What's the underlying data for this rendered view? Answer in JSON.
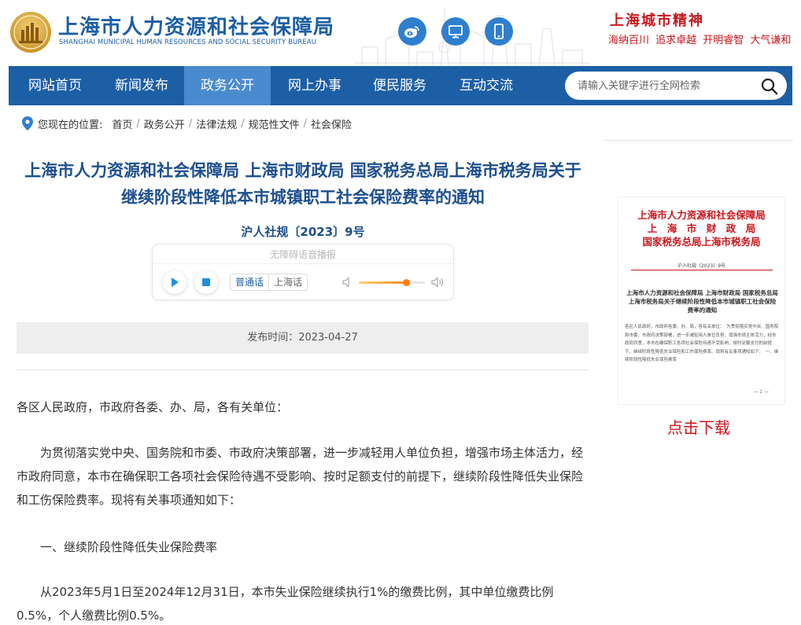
{
  "header": {
    "logo_cn": "上海市人力资源和社会保障局",
    "logo_en": "SHANGHAI MUNICIPAL HUMAN RESOURCES AND SOCIAL SECURITY BUREAU",
    "icons": [
      "weibo-icon",
      "desktop-icon",
      "mobile-icon"
    ],
    "spirit_title": "上海城市精神",
    "spirit_words": "海纳百川  追求卓越  开明睿智  大气谦和"
  },
  "nav": {
    "items": [
      {
        "label": "网站首页"
      },
      {
        "label": "新闻发布"
      },
      {
        "label": "政务公开",
        "active": true
      },
      {
        "label": "网上办事"
      },
      {
        "label": "便民服务"
      },
      {
        "label": "互动交流"
      }
    ],
    "search_placeholder": "请输入关键字进行全网检索"
  },
  "breadcrumb": {
    "label": "您现在的位置:",
    "items": [
      "首页",
      "政务公开",
      "法律法规",
      "规范性文件",
      "社会保险"
    ]
  },
  "article": {
    "title": "上海市人力资源和社会保障局 上海市财政局 国家税务总局上海市税务局关于继续阶段性降低本市城镇职工社会保险费率的通知",
    "doc_number": "沪人社规〔2023〕9号",
    "player": {
      "label": "无障碍语音播报",
      "lang_mandarin": "普通话",
      "lang_shanghai": "上海话",
      "volume_level": 0.72
    },
    "publish_time": "发布时间：2023-04-27",
    "paragraphs": [
      "各区人民政府，市政府各委、办、局，各有关单位：",
      "为贯彻落实党中央、国务院和市委、市政府决策部署，进一步减轻用人单位负担，增强市场主体活力，经市政府同意，本市在确保职工各项社会保险待遇不受影响、按时足额支付的前提下，继续阶段性降低失业保险和工伤保险费率。现将有关事项通知如下：",
      "一、继续阶段性降低失业保险费率",
      "从2023年5月1日至2024年12月31日，本市失业保险继续执行1%的缴费比例，其中单位缴费比例0.5%，个人缴费比例0.5%。"
    ]
  },
  "sidebar": {
    "preview": {
      "head_lines": [
        "上海市人力资源和社会保障局",
        "上　海　市　财　政　局",
        "国家税务总局上海市税务局"
      ],
      "doc_number": "沪人社规〔2023〕9号",
      "title": "上海市人力资源和社会保障局 上海市财政局 国家税务总局上海市税务局关于继续阶段性降低本市城镇职工社会保险费率的通知",
      "body": "各区人民政府，市政府各委、办、局，各有关单位：　为贯彻落实党中央、国务院和市委、市政府决策部署，进一步减轻用人单位负担，增强市场主体活力，经市政府同意，本市在确保职工各项社会保险待遇不受影响、按时足额支付的前提下，继续阶段性降低失业保险和工伤保险费率。现将有关事项通知如下：　一、继续阶段性降低失业保险费率",
      "page": "— 1 —"
    },
    "download_label": "点击下载"
  },
  "colors": {
    "brand_blue": "#1d5fa5",
    "nav_active": "#4a8bd0",
    "title_blue": "#1d4f8e",
    "accent_red": "#c8161d",
    "slider_orange": "#ff7f11"
  }
}
